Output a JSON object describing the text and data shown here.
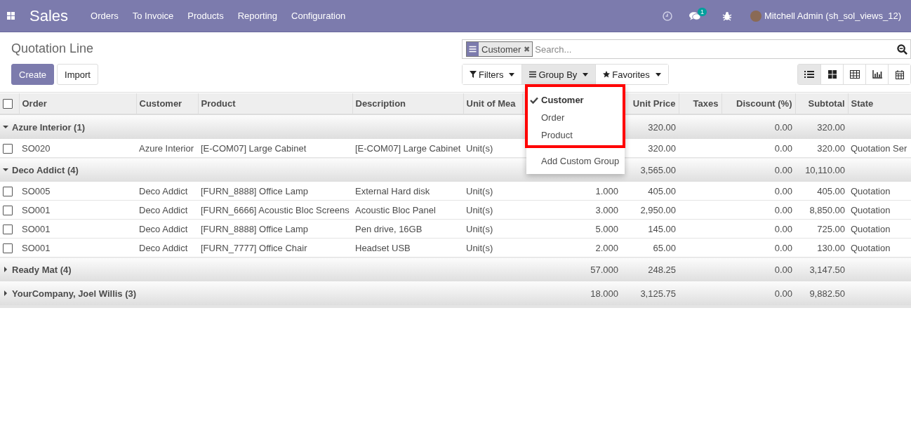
{
  "navbar": {
    "app_name": "Sales",
    "menu": [
      "Orders",
      "To Invoice",
      "Products",
      "Reporting",
      "Configuration"
    ],
    "messages_badge": "1",
    "user": "Mitchell Admin (sh_sol_views_12)"
  },
  "control_panel": {
    "title": "Quotation Line",
    "buttons": [
      {
        "label": "Create",
        "kind": "primary"
      },
      {
        "label": "Import",
        "kind": "secondary"
      }
    ],
    "search": {
      "facet": "Customer",
      "facet_remove": "✖",
      "placeholder": "Search..."
    },
    "search_options": [
      {
        "label": "Filters",
        "kind": "filter",
        "selected": false
      },
      {
        "label": "Group By",
        "kind": "group",
        "selected": true
      },
      {
        "label": "Favorites",
        "kind": "star",
        "selected": false
      }
    ],
    "views": [
      {
        "kind": "list",
        "selected": true
      },
      {
        "kind": "kanban",
        "selected": false
      },
      {
        "kind": "grid",
        "selected": false
      },
      {
        "kind": "graph",
        "selected": false
      },
      {
        "kind": "calendar",
        "selected": false
      }
    ]
  },
  "group_by_menu": {
    "items": [
      {
        "label": "Customer",
        "selected": true
      },
      {
        "label": "Order",
        "selected": false
      },
      {
        "label": "Product",
        "selected": false
      }
    ],
    "add_custom": "Add Custom Group"
  },
  "table": {
    "select_all_checked": false,
    "columns": [
      "Order",
      "Customer",
      "Product",
      "Description",
      "Unit of Mea",
      "Unit Price",
      "Taxes",
      "Discount (%)",
      "Subtotal",
      "State"
    ],
    "groups": [
      {
        "name": "Azure Interior (1)",
        "expanded": true,
        "unit_price": "320.00",
        "discount": "0.00",
        "subtotal": "320.00",
        "rows": [
          {
            "checked": false,
            "order": "SO020",
            "customer": "Azure Interior",
            "product": "[E-COM07] Large Cabinet",
            "description": "[E-COM07] Large Cabinet",
            "unit": "Unit(s)",
            "unit_price": "320.00",
            "discount": "0.00",
            "subtotal": "320.00",
            "state": "Quotation Ser"
          }
        ]
      },
      {
        "name": "Deco Addict (4)",
        "expanded": true,
        "unit_price": "3,565.00",
        "discount": "0.00",
        "subtotal": "10,110.00",
        "rows": [
          {
            "checked": false,
            "order": "SO005",
            "customer": "Deco Addict",
            "product": "[FURN_8888] Office Lamp",
            "description": "External Hard disk",
            "unit": "Unit(s)",
            "quantity": "1.000",
            "unit_price": "405.00",
            "discount": "0.00",
            "subtotal": "405.00",
            "state": "Quotation"
          },
          {
            "checked": false,
            "order": "SO001",
            "customer": "Deco Addict",
            "product": "[FURN_6666] Acoustic Bloc Screens",
            "description": "Acoustic Bloc Panel",
            "unit": "Unit(s)",
            "quantity": "3.000",
            "unit_price": "2,950.00",
            "discount": "0.00",
            "subtotal": "8,850.00",
            "state": "Quotation"
          },
          {
            "checked": false,
            "order": "SO001",
            "customer": "Deco Addict",
            "product": "[FURN_8888] Office Lamp",
            "description": "Pen drive, 16GB",
            "unit": "Unit(s)",
            "quantity": "5.000",
            "unit_price": "145.00",
            "discount": "0.00",
            "subtotal": "725.00",
            "state": "Quotation"
          },
          {
            "checked": false,
            "order": "SO001",
            "customer": "Deco Addict",
            "product": "[FURN_7777] Office Chair",
            "description": "Headset USB",
            "unit": "Unit(s)",
            "quantity": "2.000",
            "unit_price": "65.00",
            "discount": "0.00",
            "subtotal": "130.00",
            "state": "Quotation"
          }
        ]
      },
      {
        "name": "Ready Mat (4)",
        "expanded": false,
        "quantity": "57.000",
        "unit_price": "248.25",
        "discount": "0.00",
        "subtotal": "3,147.50"
      },
      {
        "name": "YourCompany, Joel Willis (3)",
        "expanded": false,
        "quantity": "18.000",
        "unit_price": "3,125.75",
        "discount": "0.00",
        "subtotal": "9,882.50"
      }
    ]
  }
}
